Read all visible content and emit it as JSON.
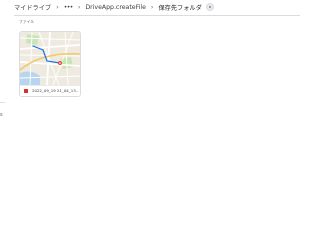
{
  "breadcrumb": {
    "root": "マイドライブ",
    "more": "•••",
    "parent": "DriveApp.createFile",
    "current": "保存先フォルダ",
    "separator": "›"
  },
  "section": {
    "label": "ファイル"
  },
  "files": [
    {
      "name": "2022_09_19 21_04_13...",
      "type_icon": "image-file-icon",
      "type_color": "#d93025",
      "thumbnail": "map-image"
    }
  ],
  "left_glyph": "s",
  "colors": {
    "background": "#ffffff",
    "text": "#3c4043",
    "secondary_text": "#5f6368",
    "border": "#dadce0",
    "map_land": "#eeeae0",
    "map_road": "#ffffff",
    "map_highway": "#f5c76a",
    "map_park": "#c8e6b5",
    "map_water": "#b7d5ee",
    "map_route": "#1a73e8",
    "map_pin": "#ea4335"
  }
}
